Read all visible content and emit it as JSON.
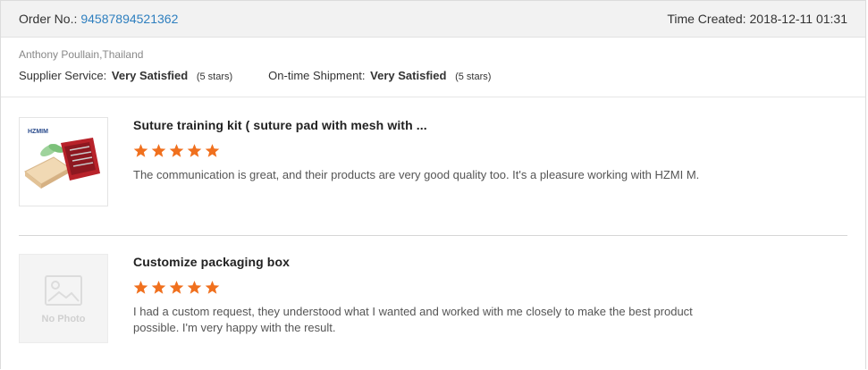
{
  "header": {
    "order_label": "Order No.:",
    "order_number": "94587894521362",
    "time_label": "Time Created:",
    "time_value": "2018-12-11 01:31"
  },
  "buyer": {
    "name": "Anthony Poullain,Thailand",
    "supplier_service_label": "Supplier Service:",
    "supplier_service_value": "Very Satisfied",
    "supplier_service_stars": "(5 stars)",
    "shipment_label": "On-time Shipment:",
    "shipment_value": "Very Satisfied",
    "shipment_stars": "(5 stars)"
  },
  "items": [
    {
      "title": "Suture training kit ( suture pad with mesh with ...",
      "rating": 5,
      "review": "The communication is great, and their products are very good quality too. It's a pleasure working with HZMI M.",
      "thumb_brand": "HZMIM"
    },
    {
      "title": "Customize packaging box",
      "rating": 5,
      "review": "I had a custom request, they understood what I wanted and worked with me closely to make the best product possible. I'm very happy with the result.",
      "thumb_placeholder": "No Photo"
    }
  ],
  "colors": {
    "star": "#f0701e",
    "link": "#2e7fbf",
    "header_bg": "#f2f2f2"
  }
}
